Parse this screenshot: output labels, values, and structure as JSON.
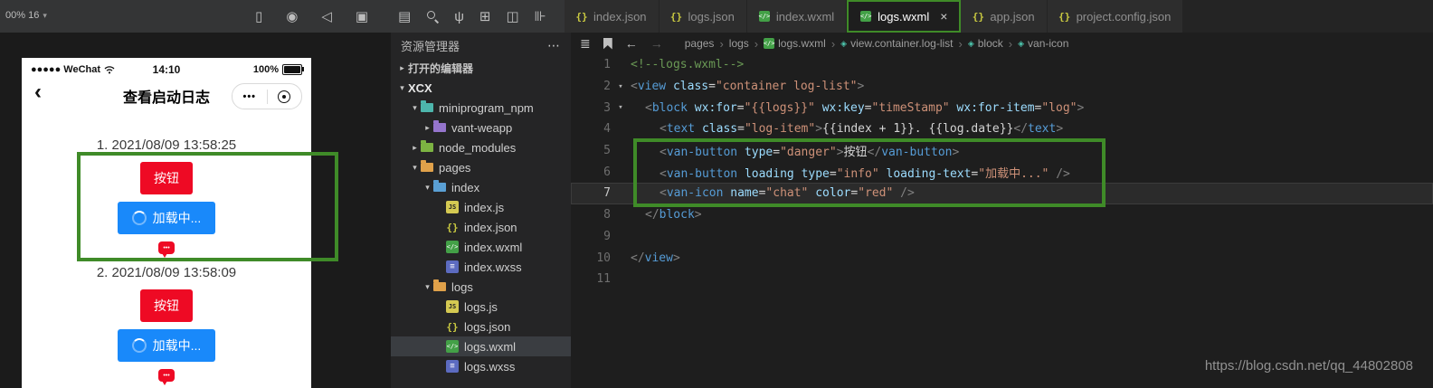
{
  "toolbar": {
    "zoom_label": "00% 16",
    "icons_device": [
      "device-icon",
      "record-icon",
      "sound-icon",
      "compile-icon"
    ],
    "icons_editor": [
      "pages-icon",
      "search-icon",
      "git-branch-icon",
      "grid-icon",
      "window-icon",
      "split-editor-icon"
    ]
  },
  "tabs": [
    {
      "label": "index.json",
      "type": "json",
      "active": false
    },
    {
      "label": "logs.json",
      "type": "json",
      "active": false
    },
    {
      "label": "index.wxml",
      "type": "wxml",
      "active": false
    },
    {
      "label": "logs.wxml",
      "type": "wxml",
      "active": true,
      "close": "×"
    },
    {
      "label": "app.json",
      "type": "json",
      "active": false
    },
    {
      "label": "project.config.json",
      "type": "json",
      "active": false
    }
  ],
  "simulator": {
    "status": {
      "carrier": "●●●●● WeChat",
      "time": "14:10",
      "battery": "100%"
    },
    "nav": {
      "back": "‹",
      "title": "查看启动日志",
      "more": "•••"
    },
    "entries": [
      {
        "date": "1. 2021/08/09 13:58:25",
        "danger_label": "按钮",
        "loading_label": "加载中..."
      },
      {
        "date": "2. 2021/08/09 13:58:09",
        "danger_label": "按钮",
        "loading_label": "加载中..."
      }
    ],
    "colors": {
      "danger": "#ee0a24",
      "info": "#1989fa"
    }
  },
  "explorer": {
    "title": "资源管理器",
    "more_label": "⋯",
    "items": [
      {
        "label": "打开的编辑器",
        "indent": 0,
        "arrow": "right",
        "kind": "section"
      },
      {
        "label": "XCX",
        "indent": 0,
        "arrow": "down",
        "kind": "root"
      },
      {
        "label": "miniprogram_npm",
        "indent": 1,
        "arrow": "down",
        "kind": "folder",
        "color": "#4db6ac"
      },
      {
        "label": "vant-weapp",
        "indent": 2,
        "arrow": "right",
        "kind": "folder",
        "color": "#9575cd"
      },
      {
        "label": "node_modules",
        "indent": 1,
        "arrow": "right",
        "kind": "folder",
        "color": "#7cb342"
      },
      {
        "label": "pages",
        "indent": 1,
        "arrow": "down",
        "kind": "folder",
        "color": "#e0a14a"
      },
      {
        "label": "index",
        "indent": 2,
        "arrow": "down",
        "kind": "folder",
        "color": "#5a9fd4"
      },
      {
        "label": "index.js",
        "indent": 3,
        "kind": "file",
        "type": "js"
      },
      {
        "label": "index.json",
        "indent": 3,
        "kind": "file",
        "type": "json"
      },
      {
        "label": "index.wxml",
        "indent": 3,
        "kind": "file",
        "type": "wxml"
      },
      {
        "label": "index.wxss",
        "indent": 3,
        "kind": "file",
        "type": "wxss"
      },
      {
        "label": "logs",
        "indent": 2,
        "arrow": "down",
        "kind": "folder",
        "color": "#e0a14a"
      },
      {
        "label": "logs.js",
        "indent": 3,
        "kind": "file",
        "type": "js"
      },
      {
        "label": "logs.json",
        "indent": 3,
        "kind": "file",
        "type": "json"
      },
      {
        "label": "logs.wxml",
        "indent": 3,
        "kind": "file",
        "type": "wxml",
        "selected": true
      },
      {
        "label": "logs.wxss",
        "indent": 3,
        "kind": "file",
        "type": "wxss"
      }
    ]
  },
  "breadcrumb": {
    "separator": "›",
    "items": [
      {
        "label": "pages"
      },
      {
        "label": "logs"
      },
      {
        "label": "logs.wxml",
        "icon": "wxml"
      },
      {
        "label": "view.container.log-list",
        "icon": "symbol"
      },
      {
        "label": "block",
        "icon": "symbol"
      },
      {
        "label": "van-icon",
        "icon": "symbol"
      }
    ]
  },
  "code": {
    "lines": [
      {
        "n": 1,
        "indent": 0,
        "fold": false,
        "current": false,
        "tokens": [
          [
            "c",
            "<!--logs.wxml-->"
          ]
        ]
      },
      {
        "n": 2,
        "indent": 0,
        "fold": true,
        "current": false,
        "tokens": [
          [
            "b",
            "<"
          ],
          [
            "t",
            "view"
          ],
          [
            "x",
            " "
          ],
          [
            "a",
            "class"
          ],
          [
            "e",
            "="
          ],
          [
            "s",
            "\"container log-list\""
          ],
          [
            "b",
            ">"
          ]
        ]
      },
      {
        "n": 3,
        "indent": 1,
        "fold": true,
        "current": false,
        "tokens": [
          [
            "b",
            "<"
          ],
          [
            "t",
            "block"
          ],
          [
            "x",
            " "
          ],
          [
            "a",
            "wx:for"
          ],
          [
            "e",
            "="
          ],
          [
            "s",
            "\"{{logs}}\""
          ],
          [
            "x",
            " "
          ],
          [
            "a",
            "wx:key"
          ],
          [
            "e",
            "="
          ],
          [
            "s",
            "\"timeStamp\""
          ],
          [
            "x",
            " "
          ],
          [
            "a",
            "wx:for-item"
          ],
          [
            "e",
            "="
          ],
          [
            "s",
            "\"log\""
          ],
          [
            "b",
            ">"
          ]
        ]
      },
      {
        "n": 4,
        "indent": 2,
        "fold": false,
        "current": false,
        "tokens": [
          [
            "b",
            "<"
          ],
          [
            "t",
            "text"
          ],
          [
            "x",
            " "
          ],
          [
            "a",
            "class"
          ],
          [
            "e",
            "="
          ],
          [
            "s",
            "\"log-item\""
          ],
          [
            "b",
            ">"
          ],
          [
            "x",
            "{{index + 1}}. {{log.date}}"
          ],
          [
            "b",
            "</"
          ],
          [
            "t",
            "text"
          ],
          [
            "b",
            ">"
          ]
        ]
      },
      {
        "n": 5,
        "indent": 2,
        "fold": false,
        "current": false,
        "tokens": [
          [
            "b",
            "<"
          ],
          [
            "t",
            "van-button"
          ],
          [
            "x",
            " "
          ],
          [
            "a",
            "type"
          ],
          [
            "e",
            "="
          ],
          [
            "s",
            "\"danger\""
          ],
          [
            "b",
            ">"
          ],
          [
            "x",
            "按钮"
          ],
          [
            "b",
            "</"
          ],
          [
            "t",
            "van-button"
          ],
          [
            "b",
            ">"
          ]
        ]
      },
      {
        "n": 6,
        "indent": 2,
        "fold": false,
        "current": false,
        "tokens": [
          [
            "b",
            "<"
          ],
          [
            "t",
            "van-button"
          ],
          [
            "x",
            " "
          ],
          [
            "a",
            "loading"
          ],
          [
            "x",
            " "
          ],
          [
            "a",
            "type"
          ],
          [
            "e",
            "="
          ],
          [
            "s",
            "\"info\""
          ],
          [
            "x",
            " "
          ],
          [
            "a",
            "loading-text"
          ],
          [
            "e",
            "="
          ],
          [
            "s",
            "\"加载中...\""
          ],
          [
            "x",
            " "
          ],
          [
            "b",
            "/>"
          ]
        ]
      },
      {
        "n": 7,
        "indent": 2,
        "fold": false,
        "current": true,
        "tokens": [
          [
            "b",
            "<"
          ],
          [
            "t",
            "van-icon"
          ],
          [
            "x",
            " "
          ],
          [
            "a",
            "name"
          ],
          [
            "e",
            "="
          ],
          [
            "s",
            "\"chat\""
          ],
          [
            "x",
            " "
          ],
          [
            "a",
            "color"
          ],
          [
            "e",
            "="
          ],
          [
            "s",
            "\"red\""
          ],
          [
            "x",
            " "
          ],
          [
            "b",
            "/>"
          ]
        ]
      },
      {
        "n": 8,
        "indent": 1,
        "fold": false,
        "current": false,
        "tokens": [
          [
            "b",
            "</"
          ],
          [
            "t",
            "block"
          ],
          [
            "b",
            ">"
          ]
        ]
      },
      {
        "n": 9,
        "indent": 0,
        "fold": false,
        "current": false,
        "tokens": []
      },
      {
        "n": 10,
        "indent": 0,
        "fold": false,
        "current": false,
        "tokens": [
          [
            "b",
            "</"
          ],
          [
            "t",
            "view"
          ],
          [
            "b",
            ">"
          ]
        ]
      },
      {
        "n": 11,
        "indent": 0,
        "fold": false,
        "current": false,
        "tokens": []
      }
    ]
  },
  "watermark": "https://blog.csdn.net/qq_44802808",
  "highlight_color": "#3f8b28"
}
